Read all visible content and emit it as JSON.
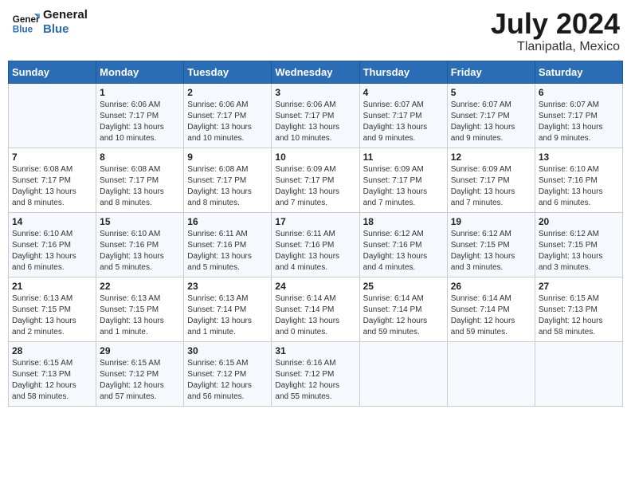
{
  "header": {
    "logo_line1": "General",
    "logo_line2": "Blue",
    "month": "July 2024",
    "location": "Tlanipatla, Mexico"
  },
  "weekdays": [
    "Sunday",
    "Monday",
    "Tuesday",
    "Wednesday",
    "Thursday",
    "Friday",
    "Saturday"
  ],
  "weeks": [
    [
      {
        "day": "",
        "info": ""
      },
      {
        "day": "1",
        "info": "Sunrise: 6:06 AM\nSunset: 7:17 PM\nDaylight: 13 hours\nand 10 minutes."
      },
      {
        "day": "2",
        "info": "Sunrise: 6:06 AM\nSunset: 7:17 PM\nDaylight: 13 hours\nand 10 minutes."
      },
      {
        "day": "3",
        "info": "Sunrise: 6:06 AM\nSunset: 7:17 PM\nDaylight: 13 hours\nand 10 minutes."
      },
      {
        "day": "4",
        "info": "Sunrise: 6:07 AM\nSunset: 7:17 PM\nDaylight: 13 hours\nand 9 minutes."
      },
      {
        "day": "5",
        "info": "Sunrise: 6:07 AM\nSunset: 7:17 PM\nDaylight: 13 hours\nand 9 minutes."
      },
      {
        "day": "6",
        "info": "Sunrise: 6:07 AM\nSunset: 7:17 PM\nDaylight: 13 hours\nand 9 minutes."
      }
    ],
    [
      {
        "day": "7",
        "info": "Sunrise: 6:08 AM\nSunset: 7:17 PM\nDaylight: 13 hours\nand 8 minutes."
      },
      {
        "day": "8",
        "info": "Sunrise: 6:08 AM\nSunset: 7:17 PM\nDaylight: 13 hours\nand 8 minutes."
      },
      {
        "day": "9",
        "info": "Sunrise: 6:08 AM\nSunset: 7:17 PM\nDaylight: 13 hours\nand 8 minutes."
      },
      {
        "day": "10",
        "info": "Sunrise: 6:09 AM\nSunset: 7:17 PM\nDaylight: 13 hours\nand 7 minutes."
      },
      {
        "day": "11",
        "info": "Sunrise: 6:09 AM\nSunset: 7:17 PM\nDaylight: 13 hours\nand 7 minutes."
      },
      {
        "day": "12",
        "info": "Sunrise: 6:09 AM\nSunset: 7:17 PM\nDaylight: 13 hours\nand 7 minutes."
      },
      {
        "day": "13",
        "info": "Sunrise: 6:10 AM\nSunset: 7:16 PM\nDaylight: 13 hours\nand 6 minutes."
      }
    ],
    [
      {
        "day": "14",
        "info": "Sunrise: 6:10 AM\nSunset: 7:16 PM\nDaylight: 13 hours\nand 6 minutes."
      },
      {
        "day": "15",
        "info": "Sunrise: 6:10 AM\nSunset: 7:16 PM\nDaylight: 13 hours\nand 5 minutes."
      },
      {
        "day": "16",
        "info": "Sunrise: 6:11 AM\nSunset: 7:16 PM\nDaylight: 13 hours\nand 5 minutes."
      },
      {
        "day": "17",
        "info": "Sunrise: 6:11 AM\nSunset: 7:16 PM\nDaylight: 13 hours\nand 4 minutes."
      },
      {
        "day": "18",
        "info": "Sunrise: 6:12 AM\nSunset: 7:16 PM\nDaylight: 13 hours\nand 4 minutes."
      },
      {
        "day": "19",
        "info": "Sunrise: 6:12 AM\nSunset: 7:15 PM\nDaylight: 13 hours\nand 3 minutes."
      },
      {
        "day": "20",
        "info": "Sunrise: 6:12 AM\nSunset: 7:15 PM\nDaylight: 13 hours\nand 3 minutes."
      }
    ],
    [
      {
        "day": "21",
        "info": "Sunrise: 6:13 AM\nSunset: 7:15 PM\nDaylight: 13 hours\nand 2 minutes."
      },
      {
        "day": "22",
        "info": "Sunrise: 6:13 AM\nSunset: 7:15 PM\nDaylight: 13 hours\nand 1 minute."
      },
      {
        "day": "23",
        "info": "Sunrise: 6:13 AM\nSunset: 7:14 PM\nDaylight: 13 hours\nand 1 minute."
      },
      {
        "day": "24",
        "info": "Sunrise: 6:14 AM\nSunset: 7:14 PM\nDaylight: 13 hours\nand 0 minutes."
      },
      {
        "day": "25",
        "info": "Sunrise: 6:14 AM\nSunset: 7:14 PM\nDaylight: 12 hours\nand 59 minutes."
      },
      {
        "day": "26",
        "info": "Sunrise: 6:14 AM\nSunset: 7:14 PM\nDaylight: 12 hours\nand 59 minutes."
      },
      {
        "day": "27",
        "info": "Sunrise: 6:15 AM\nSunset: 7:13 PM\nDaylight: 12 hours\nand 58 minutes."
      }
    ],
    [
      {
        "day": "28",
        "info": "Sunrise: 6:15 AM\nSunset: 7:13 PM\nDaylight: 12 hours\nand 58 minutes."
      },
      {
        "day": "29",
        "info": "Sunrise: 6:15 AM\nSunset: 7:12 PM\nDaylight: 12 hours\nand 57 minutes."
      },
      {
        "day": "30",
        "info": "Sunrise: 6:15 AM\nSunset: 7:12 PM\nDaylight: 12 hours\nand 56 minutes."
      },
      {
        "day": "31",
        "info": "Sunrise: 6:16 AM\nSunset: 7:12 PM\nDaylight: 12 hours\nand 55 minutes."
      },
      {
        "day": "",
        "info": ""
      },
      {
        "day": "",
        "info": ""
      },
      {
        "day": "",
        "info": ""
      }
    ]
  ]
}
